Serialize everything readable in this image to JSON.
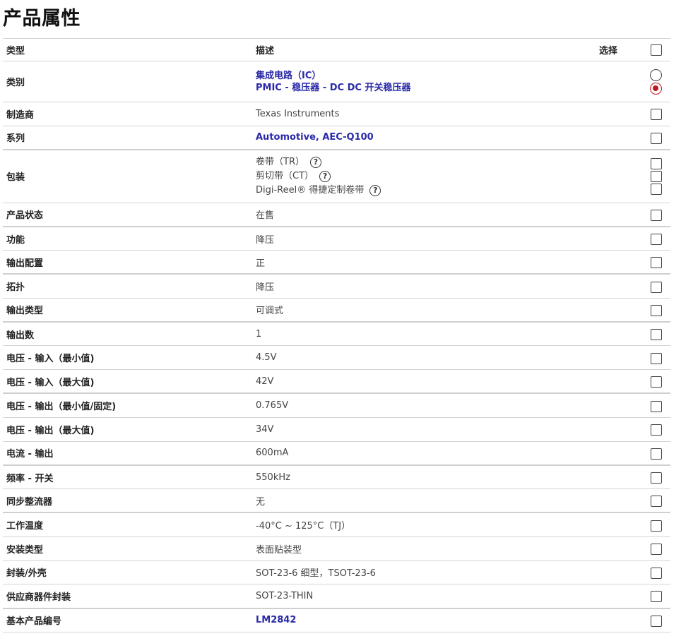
{
  "page_title": "产品属性",
  "header": {
    "type": "类型",
    "desc": "描述",
    "select": "选择"
  },
  "category": {
    "label": "类别",
    "lines": [
      "集成电路（IC）",
      "PMIC - 稳压器 - DC DC 开关稳压器"
    ],
    "selected_index": 1
  },
  "manufacturer": {
    "label": "制造商",
    "value": "Texas Instruments"
  },
  "series": {
    "label": "系列",
    "value": "Automotive, AEC-Q100"
  },
  "packaging": {
    "label": "包装",
    "options": [
      "卷带（TR）",
      "剪切带（CT）",
      "Digi-Reel® 得捷定制卷带"
    ],
    "help_icon": "question-circle-icon"
  },
  "rows": [
    {
      "label": "产品状态",
      "value": "在售"
    },
    {
      "label": "功能",
      "value": "降压"
    },
    {
      "label": "输出配置",
      "value": "正"
    },
    {
      "label": "拓扑",
      "value": "降压"
    },
    {
      "label": "输出类型",
      "value": "可调式"
    },
    {
      "label": "输出数",
      "value": "1"
    },
    {
      "label": "电压 - 输入（最小值)",
      "value": "4.5V"
    },
    {
      "label": "电压 - 输入（最大值)",
      "value": "42V"
    },
    {
      "label": "电压 - 输出（最小值/固定)",
      "value": "0.765V"
    },
    {
      "label": "电压 - 输出（最大值)",
      "value": "34V"
    },
    {
      "label": "电流 - 输出",
      "value": "600mA"
    },
    {
      "label": "频率 - 开关",
      "value": "550kHz"
    },
    {
      "label": "同步整流器",
      "value": "无"
    },
    {
      "label": "工作温度",
      "value": "-40°C ~ 125°C（TJ）"
    },
    {
      "label": "安装类型",
      "value": "表面贴装型"
    },
    {
      "label": "封装/外壳",
      "value": "SOT-23-6 细型，TSOT-23-6"
    },
    {
      "label": "供应商器件封装",
      "value": "SOT-23-THIN"
    }
  ],
  "base_part": {
    "label": "基本产品编号",
    "value": "LM2842"
  },
  "colors": {
    "link": "#2a2aa8",
    "radio_selected": "#c0161c",
    "border": "#d4d4d4"
  }
}
